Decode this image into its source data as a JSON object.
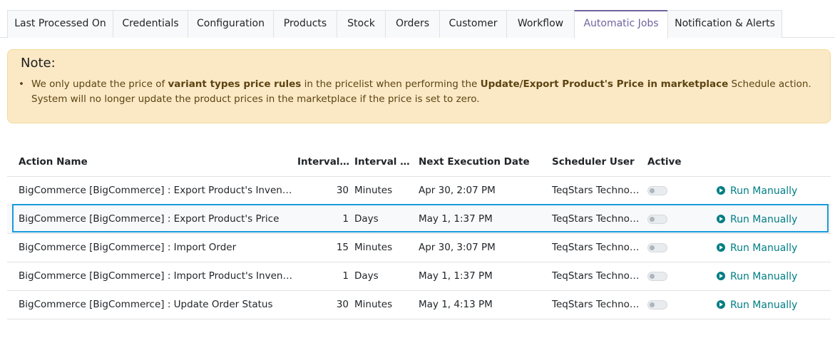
{
  "tabs": [
    {
      "label": "Last Processed On",
      "active": false
    },
    {
      "label": "Credentials",
      "active": false
    },
    {
      "label": "Configuration",
      "active": false
    },
    {
      "label": "Products",
      "active": false
    },
    {
      "label": "Stock",
      "active": false
    },
    {
      "label": "Orders",
      "active": false
    },
    {
      "label": "Customer",
      "active": false
    },
    {
      "label": "Workflow",
      "active": false
    },
    {
      "label": "Automatic Jobs",
      "active": true
    },
    {
      "label": "Notification & Alerts",
      "active": false
    }
  ],
  "note": {
    "title": "Note:",
    "text_1": "We only update the price of ",
    "bold_1": "variant types price rules",
    "text_2": " in the pricelist when performing the ",
    "bold_2": "Update/Export Product's Price in marketplace",
    "text_3": " Schedule action. System will no longer update the product prices in the marketplace if the price is set to zero."
  },
  "table": {
    "headers": {
      "action_name": "Action Name",
      "interval_number": "Interval ...",
      "interval_unit": "Interval U...",
      "next_execution": "Next Execution Date",
      "scheduler_user": "Scheduler User",
      "active": "Active"
    },
    "run_label": "Run Manually",
    "rows": [
      {
        "name": "BigCommerce [BigCommerce] : Export Product's Inventory",
        "interval": "30",
        "unit": "Minutes",
        "next": "Apr 30, 2:07 PM",
        "user": "TeqStars Technol...",
        "active": false
      },
      {
        "name": "BigCommerce [BigCommerce] : Export Product's Price",
        "interval": "1",
        "unit": "Days",
        "next": "May 1, 1:37 PM",
        "user": "TeqStars Technol...",
        "active": false,
        "selected": true
      },
      {
        "name": "BigCommerce [BigCommerce] : Import Order",
        "interval": "15",
        "unit": "Minutes",
        "next": "Apr 30, 3:07 PM",
        "user": "TeqStars Technol...",
        "active": false
      },
      {
        "name": "BigCommerce [BigCommerce] : Import Product's Inventory",
        "interval": "1",
        "unit": "Days",
        "next": "May 1, 1:37 PM",
        "user": "TeqStars Technol...",
        "active": false
      },
      {
        "name": "BigCommerce [BigCommerce] : Update Order Status",
        "interval": "30",
        "unit": "Minutes",
        "next": "May 1, 4:13 PM",
        "user": "TeqStars Technol...",
        "active": false
      }
    ]
  },
  "colors": {
    "accent": "#71639e",
    "link": "#017e84",
    "note_bg": "#fbe9c6",
    "focus": "#1a9bdc"
  }
}
